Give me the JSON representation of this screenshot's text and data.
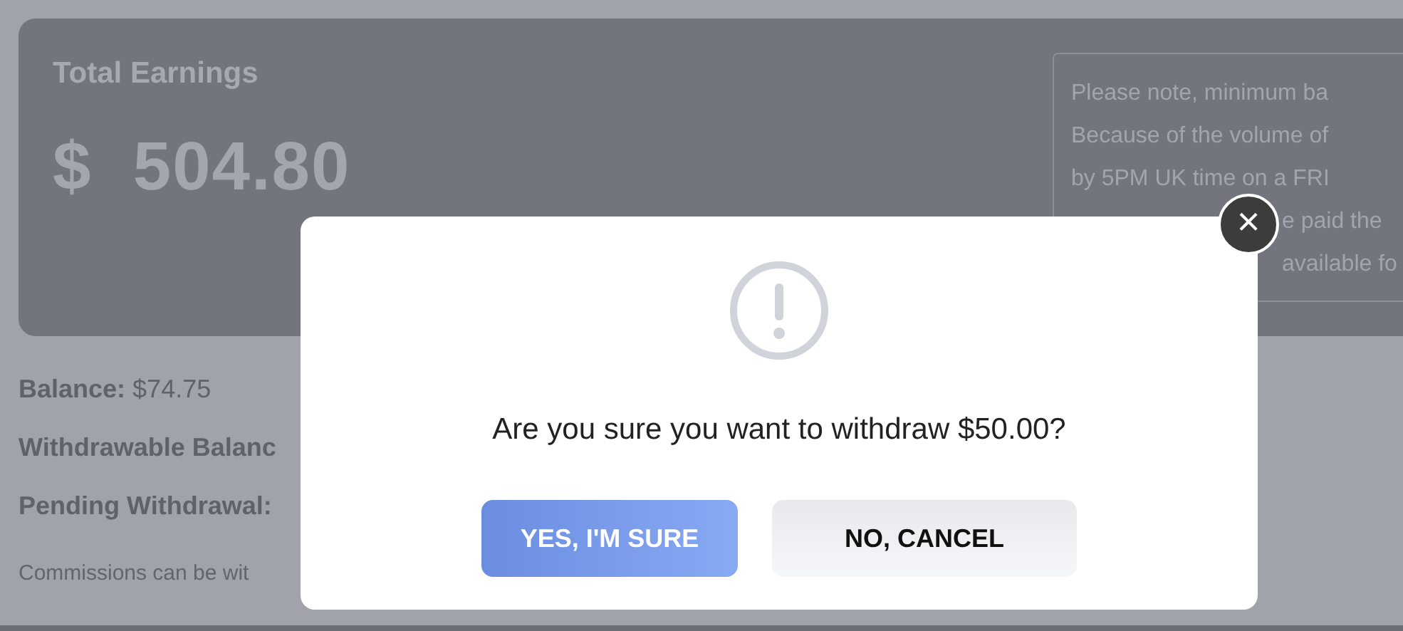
{
  "earnings": {
    "title": "Total Earnings",
    "currency": "$",
    "amount": "504.80"
  },
  "note_lines": [
    {
      "text": "Please note, minimum ba",
      "covered": false
    },
    {
      "text": "Because of the volume of",
      "covered": false
    },
    {
      "text": "by 5PM UK time on a FRI",
      "covered": false
    },
    {
      "text": "e paid the",
      "covered": true
    },
    {
      "text": "available fo",
      "covered": true
    }
  ],
  "summary": [
    {
      "label": "Balance:",
      "value": "$74.75"
    },
    {
      "label": "Withdrawable Balanc"
    },
    {
      "label": "Pending Withdrawal:"
    }
  ],
  "footnote": "Commissions can be wit",
  "dialog": {
    "message": "Are you sure you want to withdraw $50.00?",
    "confirm": "YES, I'M SURE",
    "cancel": "NO, CANCEL",
    "close": "×"
  }
}
